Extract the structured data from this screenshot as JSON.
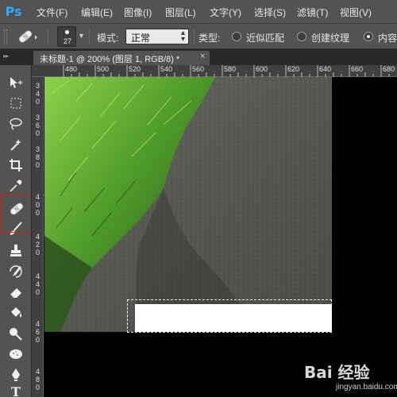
{
  "app": {
    "logo": "Ps"
  },
  "menu": [
    {
      "label": "文件(F)"
    },
    {
      "label": "编辑(E)"
    },
    {
      "label": "图像(I)"
    },
    {
      "label": "图层(L)"
    },
    {
      "label": "文字(Y)"
    },
    {
      "label": "选择(S)"
    },
    {
      "label": "滤镜(T)"
    },
    {
      "label": "视图(V)"
    }
  ],
  "options": {
    "brush_size": "27",
    "mode_label": "模式:",
    "mode_value": "正常",
    "type_label": "类型:",
    "type_options": [
      {
        "label": "近似匹配",
        "selected": false
      },
      {
        "label": "创建纹理",
        "selected": false
      },
      {
        "label": "内容",
        "selected": true
      }
    ]
  },
  "document": {
    "tab_title": "未标题-1 @ 200% (图层 1, RGB/8) *",
    "close_glyph": "×"
  },
  "ruler": {
    "horizontal": [
      "480",
      "500",
      "520",
      "540",
      "560",
      "580",
      "600",
      "620",
      "640",
      "660",
      "680"
    ],
    "vertical": [
      "3\n4\n0",
      "3\n6\n0",
      "3\n8\n0",
      "4\n0\n0",
      "4\n2\n0",
      "4\n4\n0",
      "4\n6\n0",
      "4\n8\n0"
    ]
  },
  "tools": [
    {
      "name": "move-tool-icon"
    },
    {
      "name": "marquee-tool-icon"
    },
    {
      "name": "lasso-tool-icon"
    },
    {
      "name": "magic-wand-tool-icon"
    },
    {
      "name": "crop-tool-icon"
    },
    {
      "name": "eyedropper-tool-icon"
    },
    {
      "name": "spot-healing-brush-tool-icon",
      "active": true
    },
    {
      "name": "brush-tool-icon"
    },
    {
      "name": "clone-stamp-tool-icon"
    },
    {
      "name": "history-brush-tool-icon"
    },
    {
      "name": "eraser-tool-icon"
    },
    {
      "name": "paint-bucket-tool-icon"
    },
    {
      "name": "dodge-tool-icon"
    },
    {
      "name": "sponge-tool-icon"
    },
    {
      "name": "pen-tool-icon"
    },
    {
      "name": "type-tool-icon",
      "glyph": "T"
    }
  ],
  "colors": {
    "menubar": "#535353",
    "canvas_bg": "#000000",
    "highlight_box": "#d0201c",
    "ps_logo": "#31a8ff"
  },
  "watermark": {
    "brand": "Bai 经验",
    "url": "jingyan.baidu.com"
  }
}
